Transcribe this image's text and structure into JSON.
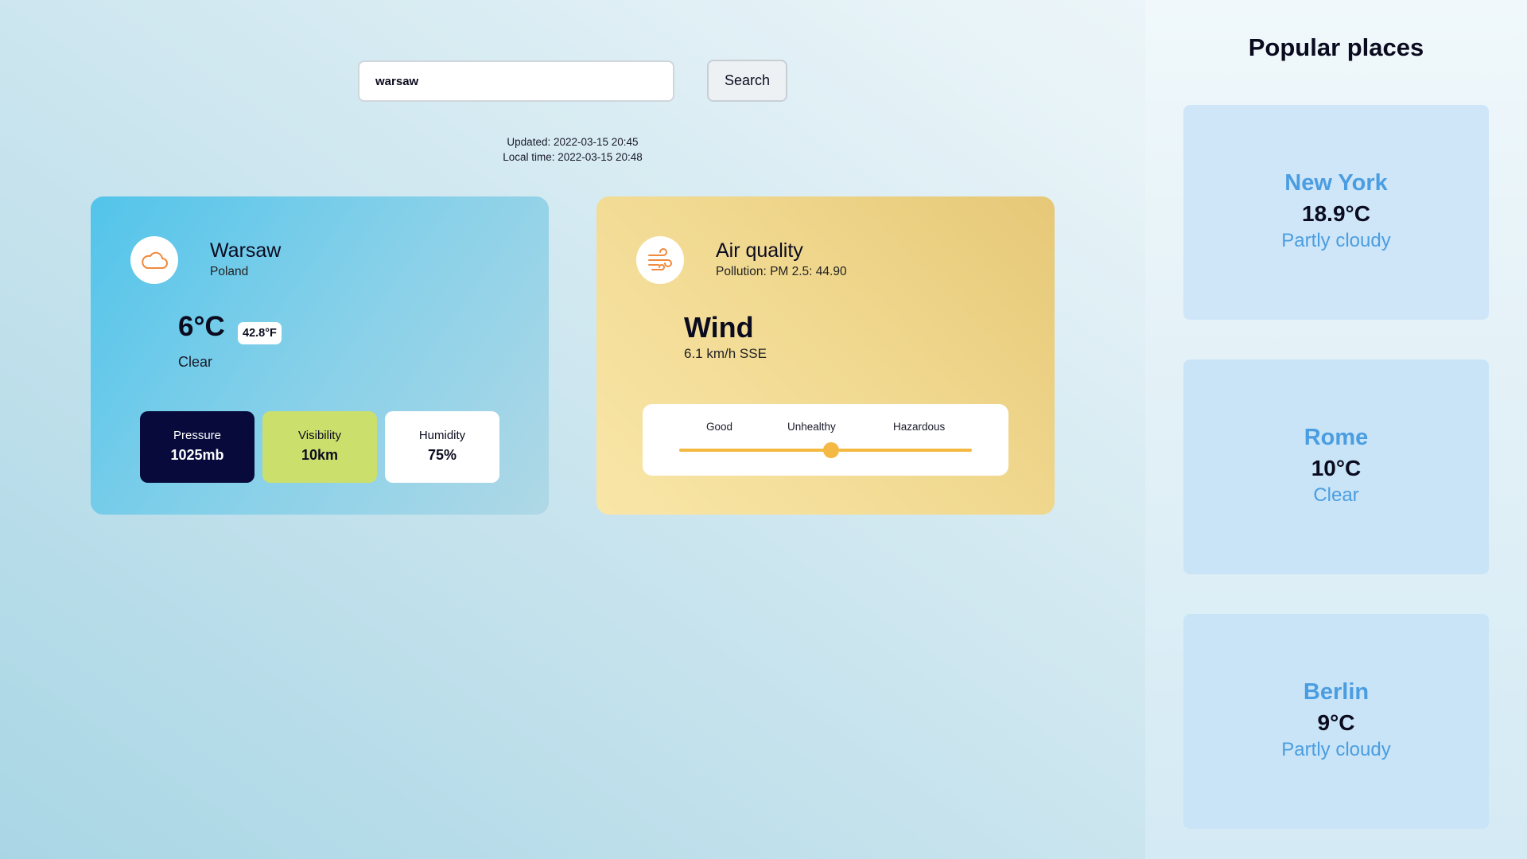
{
  "search": {
    "value": "warsaw",
    "button_label": "Search"
  },
  "updated": {
    "updated_text": "Updated: 2022-03-15 20:45",
    "local_time_text": "Local time: 2022-03-15 20:48"
  },
  "weather": {
    "icon": "cloud-icon",
    "city": "Warsaw",
    "country": "Poland",
    "temp_c": "6°C",
    "temp_f": "42.8°F",
    "condition": "Clear",
    "stats": {
      "pressure": {
        "label": "Pressure",
        "value": "1025mb"
      },
      "visibility": {
        "label": "Visibility",
        "value": "10km"
      },
      "humidity": {
        "label": "Humidity",
        "value": "75%"
      }
    }
  },
  "air": {
    "icon": "wind-icon",
    "title": "Air quality",
    "pollution": "Pollution: PM 2.5: 44.90",
    "wind_title": "Wind",
    "wind_value": "6.1 km/h SSE",
    "scale_labels": {
      "good": "Good",
      "unhealthy": "Unhealthy",
      "hazardous": "Hazardous"
    },
    "level_fraction": 0.52
  },
  "sidebar": {
    "title": "Popular places",
    "places": [
      {
        "name": "New York",
        "temp": "18.9°C",
        "condition": "Partly cloudy"
      },
      {
        "name": "Rome",
        "temp": "10°C",
        "condition": "Clear"
      },
      {
        "name": "Berlin",
        "temp": "9°C",
        "condition": "Partly cloudy"
      }
    ]
  },
  "colors": {
    "accent_orange": "#f08a3c",
    "slider": "#f4b942",
    "place_name": "#4a9de0",
    "pressure_bg": "#070a3a",
    "visibility_bg": "#cbe06c"
  }
}
